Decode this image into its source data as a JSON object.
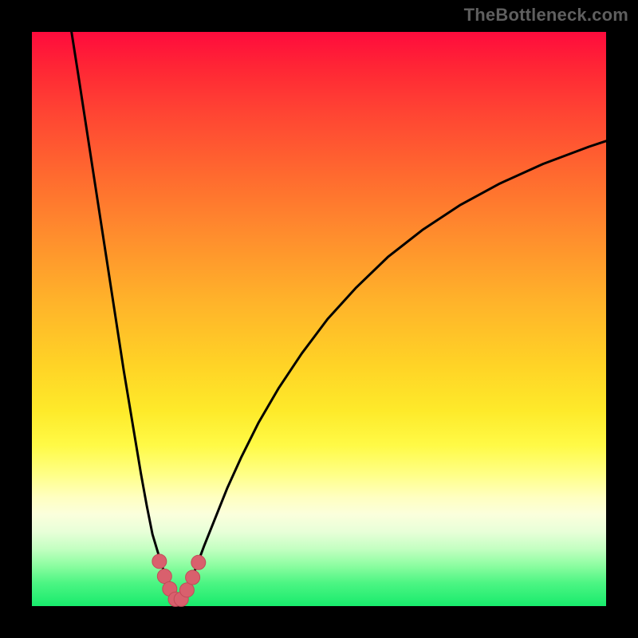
{
  "watermark": {
    "text": "TheBottleneck.com"
  },
  "colors": {
    "frame": "#000000",
    "curve": "#000000",
    "markers_fill": "#d9606d",
    "markers_stroke": "#c24b58"
  },
  "chart_data": {
    "type": "line",
    "title": "",
    "xlabel": "",
    "ylabel": "",
    "xlim": [
      0,
      100
    ],
    "ylim": [
      0,
      100
    ],
    "grid": false,
    "legend": false,
    "notes": "Bottleneck-style curve: y represents bottleneck magnitude; minimum ~0 near x≈25; axes and units not shown in image so values are read off pixel positions normalized to 0–100.",
    "series": [
      {
        "name": "left-branch",
        "x": [
          6.9,
          8,
          9,
          10,
          11,
          12,
          13,
          14,
          15,
          16,
          17,
          18,
          19,
          20,
          21,
          22.5,
          24,
          25.5
        ],
        "y": [
          100,
          93,
          86.5,
          80,
          73.5,
          67,
          60.5,
          54,
          47.5,
          41,
          35,
          29,
          23,
          17.5,
          12.5,
          7.5,
          3,
          0.5
        ]
      },
      {
        "name": "right-branch",
        "x": [
          25.5,
          27,
          28.5,
          30,
          32,
          34,
          36.5,
          39.5,
          43,
          47,
          51.5,
          56.5,
          62,
          68,
          74.5,
          81.5,
          89,
          97,
          100
        ],
        "y": [
          0.5,
          3,
          6.5,
          10.5,
          15.5,
          20.5,
          26,
          32,
          38,
          44,
          50,
          55.5,
          60.8,
          65.5,
          69.8,
          73.6,
          77,
          80,
          81
        ]
      },
      {
        "name": "markers-near-minimum",
        "x": [
          22.2,
          23.1,
          24.0,
          25.0,
          26.0,
          27.0,
          28.0,
          29.0
        ],
        "y": [
          7.8,
          5.2,
          3.0,
          1.2,
          1.2,
          2.8,
          5.0,
          7.6
        ]
      }
    ]
  }
}
